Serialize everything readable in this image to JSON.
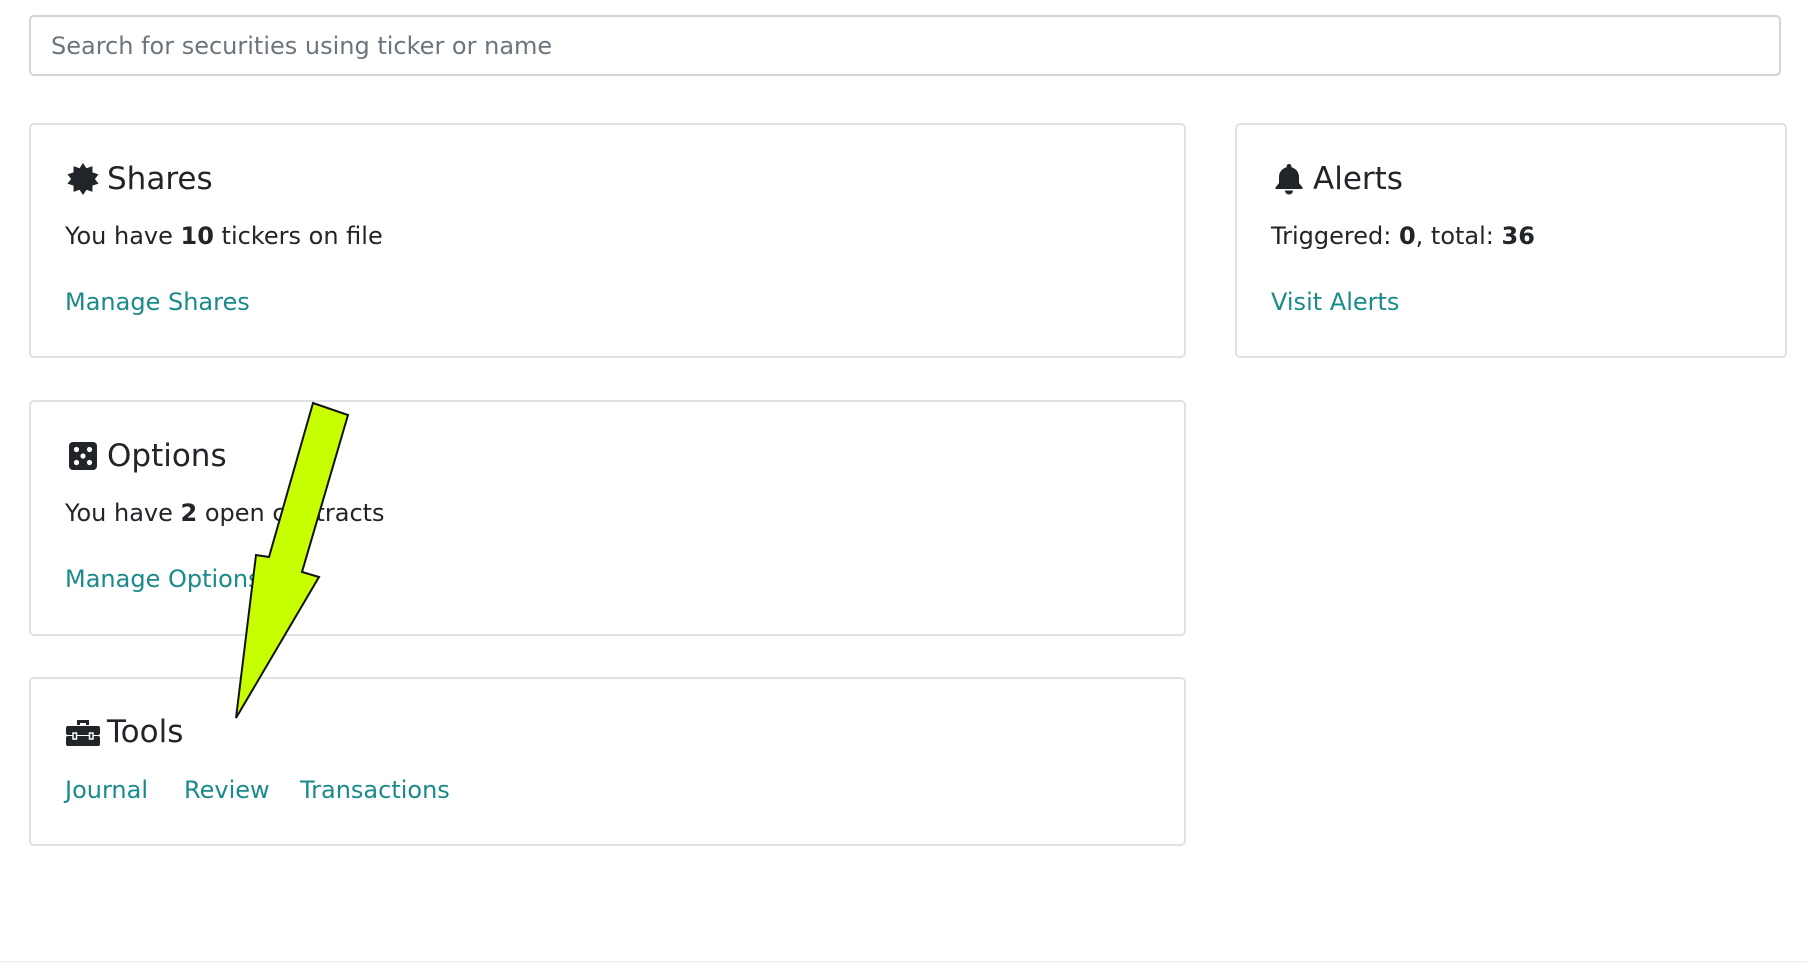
{
  "search": {
    "placeholder": "Search for securities using ticker or name",
    "value": ""
  },
  "shares": {
    "title": "Shares",
    "icon": "certificate-icon",
    "text_prefix": "You have ",
    "count": "10",
    "text_suffix": " tickers on file",
    "link": "Manage Shares"
  },
  "alerts": {
    "title": "Alerts",
    "icon": "bell-icon",
    "triggered_label": "Triggered: ",
    "triggered": "0",
    "total_label": ", total: ",
    "total": "36",
    "link": "Visit Alerts"
  },
  "options": {
    "title": "Options",
    "icon": "dice-icon",
    "text_prefix": "You have ",
    "count": "2",
    "text_suffix": " open contracts",
    "link": "Manage Options"
  },
  "tools": {
    "title": "Tools",
    "icon": "toolbox-icon",
    "links": [
      "Journal",
      "Review",
      "Transactions"
    ]
  },
  "annotation": {
    "type": "arrow",
    "color": "#c8ff00",
    "icon": "arrow-annotation"
  },
  "colors": {
    "link": "#1a8a8a",
    "border": "#dfe2e5",
    "text": "#212529"
  }
}
